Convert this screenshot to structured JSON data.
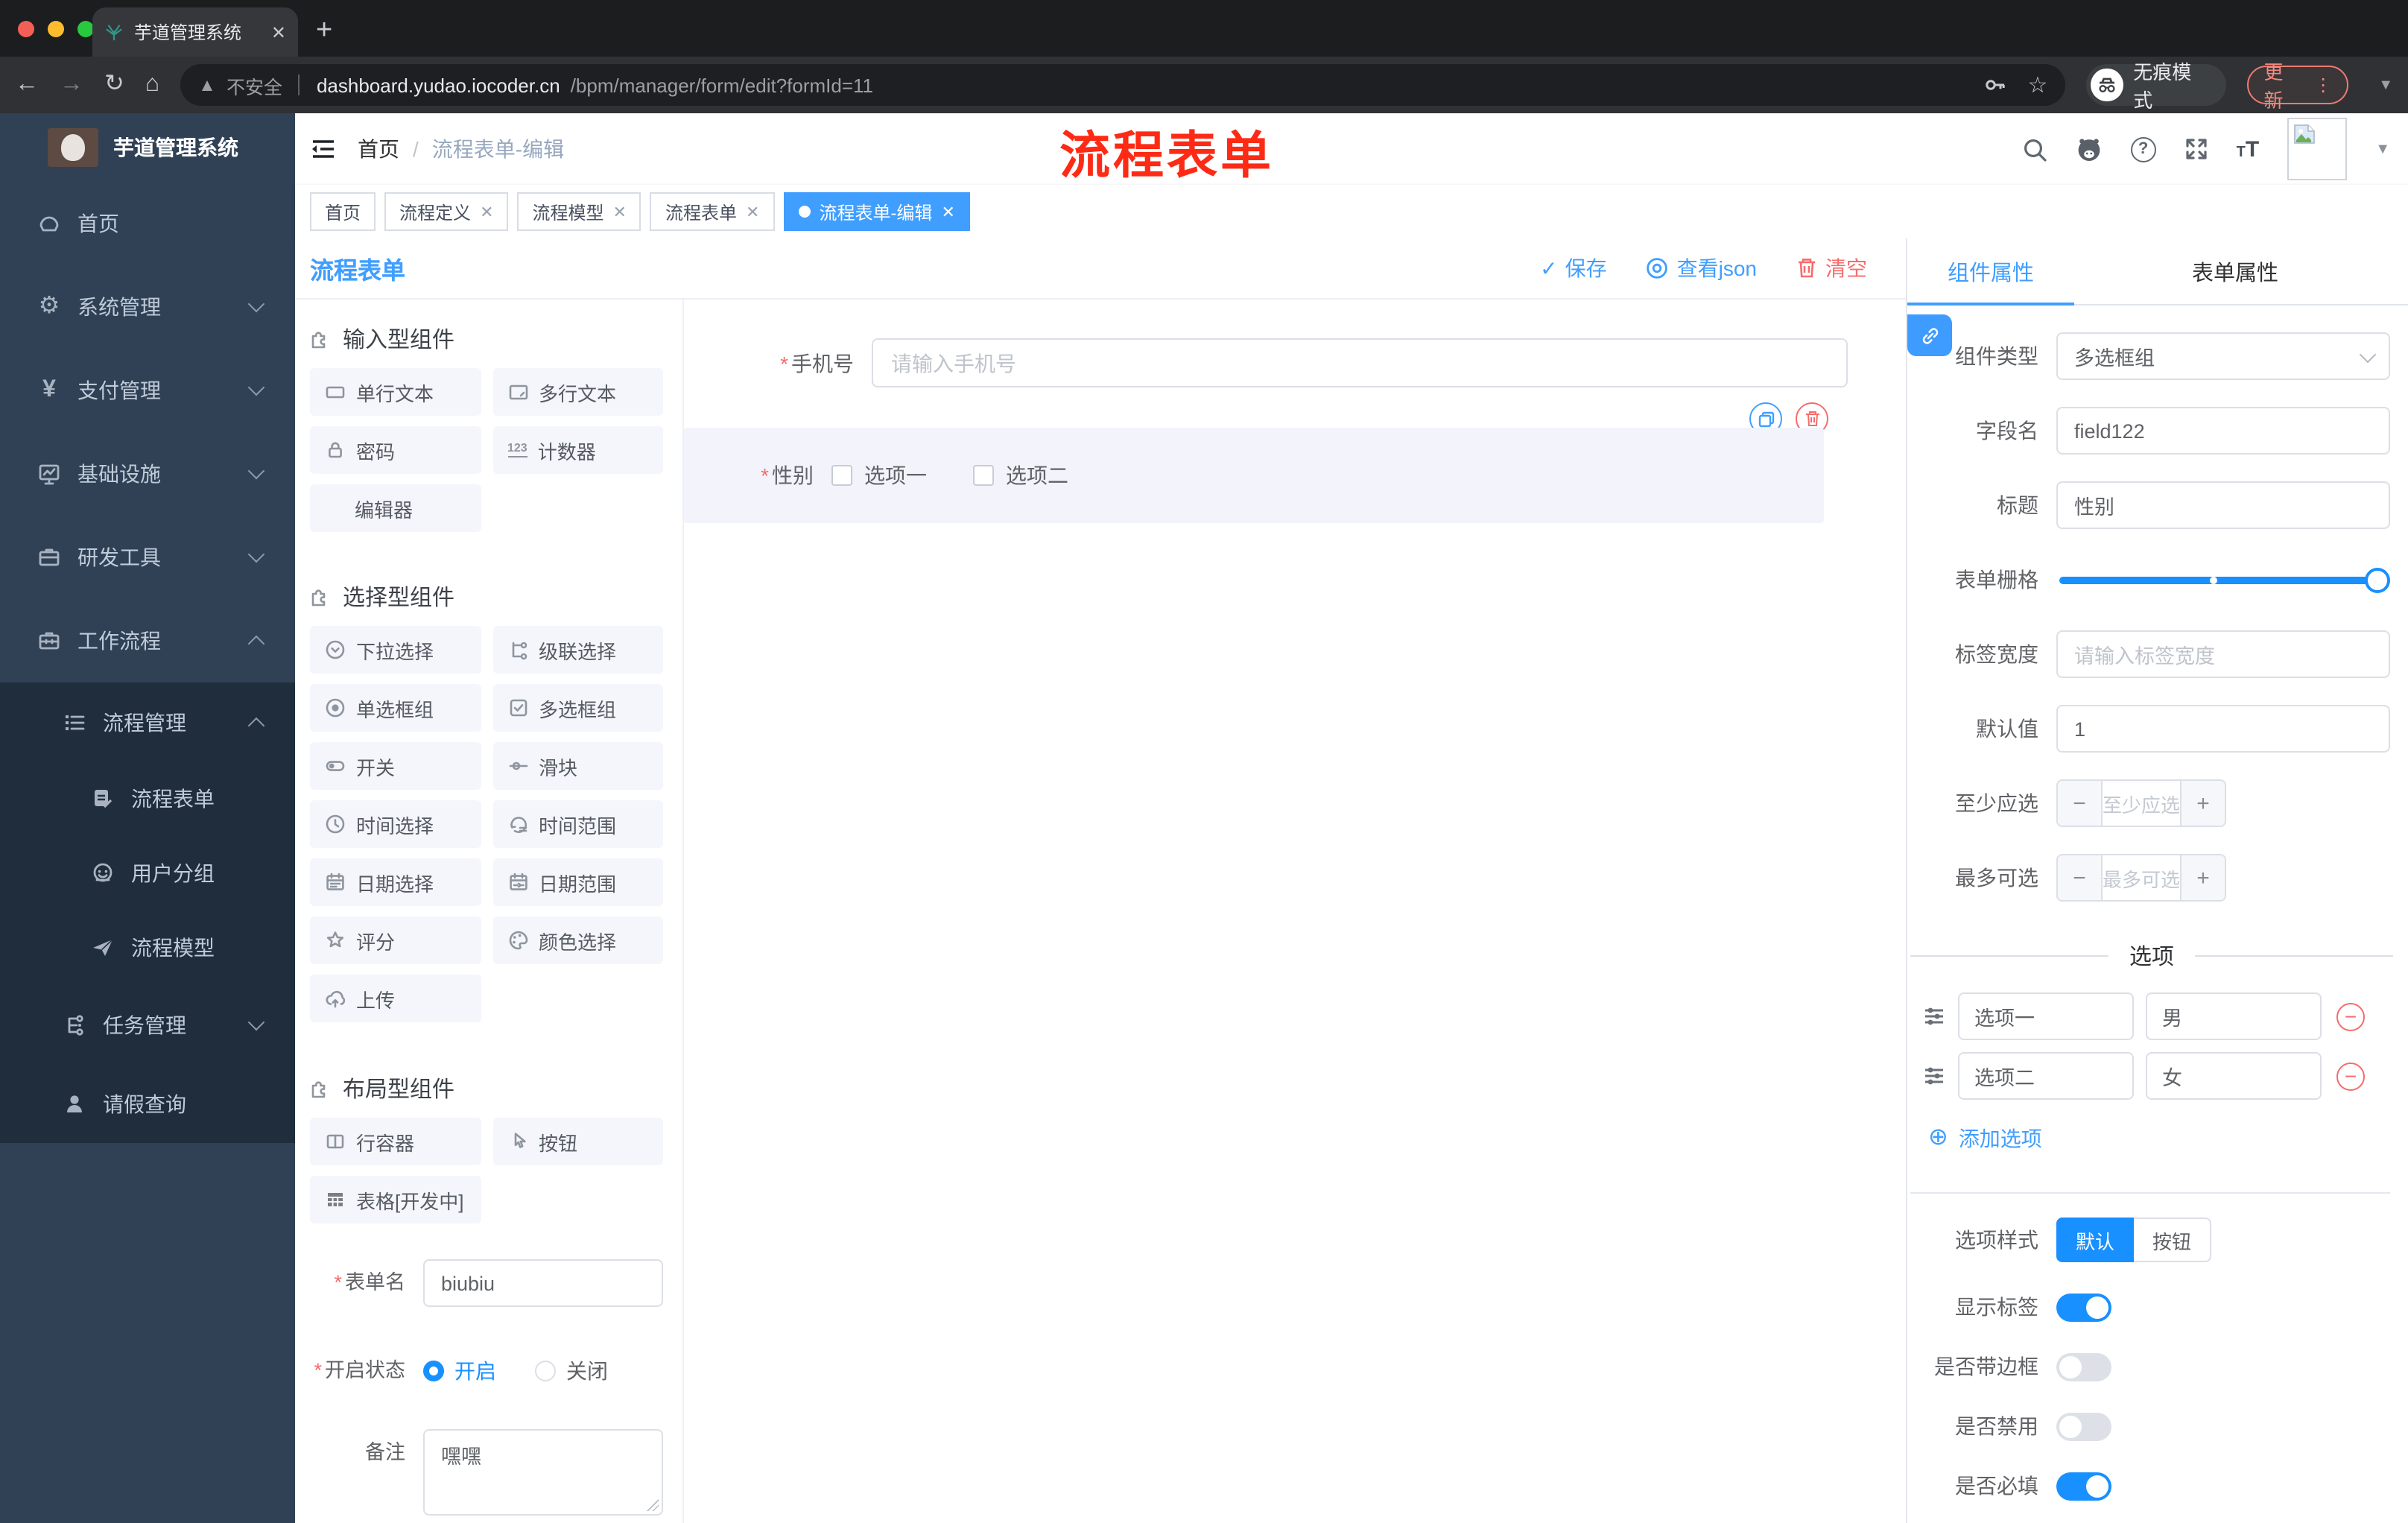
{
  "browser": {
    "tab_title": "芋道管理系统",
    "new_tab": "+",
    "security": "不安全",
    "url_host": "dashboard.yudao.iocoder.cn",
    "url_path": "/bpm/manager/form/edit?formId=11",
    "incognito": "无痕模式",
    "update": "更新"
  },
  "sidebar": {
    "app_title": "芋道管理系统",
    "items": [
      {
        "label": "首页"
      },
      {
        "label": "系统管理"
      },
      {
        "label": "支付管理"
      },
      {
        "label": "基础设施"
      },
      {
        "label": "研发工具"
      },
      {
        "label": "工作流程"
      }
    ],
    "sub": [
      {
        "label": "流程管理"
      },
      {
        "label": "流程表单"
      },
      {
        "label": "用户分组"
      },
      {
        "label": "流程模型"
      },
      {
        "label": "任务管理"
      },
      {
        "label": "请假查询"
      }
    ]
  },
  "header": {
    "breadcrumb_home": "首页",
    "breadcrumb_sep": "/",
    "breadcrumb_current": "流程表单-编辑",
    "watermark": "流程表单"
  },
  "tags": [
    {
      "label": "首页"
    },
    {
      "label": "流程定义"
    },
    {
      "label": "流程模型"
    },
    {
      "label": "流程表单"
    },
    {
      "label": "流程表单-编辑"
    }
  ],
  "toolbar": {
    "title": "流程表单",
    "save": "保存",
    "view_json": "查看json",
    "clear": "清空"
  },
  "palette": {
    "sections": [
      {
        "title": "输入型组件",
        "items": [
          {
            "icon": "input-icon",
            "label": "单行文本"
          },
          {
            "icon": "textarea-icon",
            "label": "多行文本"
          },
          {
            "icon": "lock-icon",
            "label": "密码"
          },
          {
            "icon": "counter-icon",
            "label": "计数器",
            "icon_text": "123"
          },
          {
            "icon": "none",
            "label": "编辑器"
          }
        ]
      },
      {
        "title": "选择型组件",
        "items": [
          {
            "icon": "select-icon",
            "label": "下拉选择"
          },
          {
            "icon": "cascade-icon",
            "label": "级联选择"
          },
          {
            "icon": "radio-icon",
            "label": "单选框组"
          },
          {
            "icon": "checkbox-icon",
            "label": "多选框组"
          },
          {
            "icon": "switch-icon",
            "label": "开关"
          },
          {
            "icon": "slider-icon",
            "label": "滑块"
          },
          {
            "icon": "time-icon",
            "label": "时间选择"
          },
          {
            "icon": "time-range-icon",
            "label": "时间范围"
          },
          {
            "icon": "date-icon",
            "label": "日期选择"
          },
          {
            "icon": "date-range-icon",
            "label": "日期范围"
          },
          {
            "icon": "star-icon",
            "label": "评分"
          },
          {
            "icon": "palette-icon",
            "label": "颜色选择"
          },
          {
            "icon": "upload-icon",
            "label": "上传"
          }
        ]
      },
      {
        "title": "布局型组件",
        "items": [
          {
            "icon": "columns-icon",
            "label": "行容器"
          },
          {
            "icon": "pointer-icon",
            "label": "按钮"
          },
          {
            "icon": "table-icon",
            "label": "表格[开发中]"
          }
        ]
      }
    ]
  },
  "form_meta": {
    "name_label": "表单名",
    "name_value": "biubiu",
    "status_label": "开启状态",
    "status_on": "开启",
    "status_off": "关闭",
    "remark_label": "备注",
    "remark_value": "嘿嘿"
  },
  "canvas": {
    "phone_label": "手机号",
    "phone_placeholder": "请输入手机号",
    "gender_label": "性别",
    "gender_options": [
      {
        "label": "选项一"
      },
      {
        "label": "选项二"
      }
    ]
  },
  "props": {
    "tabs": [
      {
        "label": "组件属性"
      },
      {
        "label": "表单属性"
      }
    ],
    "component_type_label": "组件类型",
    "component_type_value": "多选框组",
    "field_name_label": "字段名",
    "field_name_value": "field122",
    "title_label": "标题",
    "title_value": "性别",
    "grid_label": "表单栅格",
    "label_width_label": "标签宽度",
    "label_width_placeholder": "请输入标签宽度",
    "default_label": "默认值",
    "default_value": "1",
    "min_label": "至少应选",
    "min_placeholder": "至少应选",
    "max_label": "最多可选",
    "max_placeholder": "最多可选",
    "options_title": "选项",
    "options": [
      {
        "name": "选项一",
        "value": "男"
      },
      {
        "name": "选项二",
        "value": "女"
      }
    ],
    "add_option": "添加选项",
    "style_label": "选项样式",
    "style_default": "默认",
    "style_button": "按钮",
    "switches": [
      {
        "label": "显示标签",
        "on": true
      },
      {
        "label": "是否带边框",
        "on": false
      },
      {
        "label": "是否禁用",
        "on": false
      },
      {
        "label": "是否必填",
        "on": true
      }
    ]
  },
  "colors": {
    "accent": "#409eff",
    "control_blue": "#1890ff",
    "danger": "#f56c6c",
    "watermark_red": "#fd2b15",
    "sidebar_bg": "#304156",
    "submenu_bg": "#1f2d3d"
  }
}
